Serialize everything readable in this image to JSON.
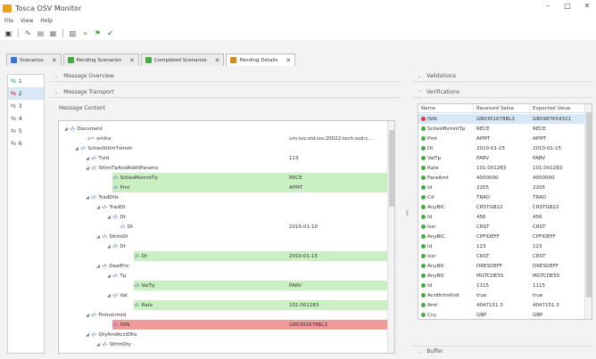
{
  "app": {
    "title": "Tosca OSV Monitor",
    "win_min": "–",
    "win_max": "□",
    "win_close": "✕"
  },
  "menu": [
    "File",
    "View",
    "Help"
  ],
  "tabs": [
    {
      "label": "Scenarios",
      "color": "#3a78c5",
      "active": false
    },
    {
      "label": "Pending Scenarios",
      "color": "#4aa64a",
      "active": false
    },
    {
      "label": "Completed Scenarios",
      "color": "#4aa64a",
      "active": false
    },
    {
      "label": "Pending Details",
      "color": "#d08a2b",
      "active": true
    }
  ],
  "tab_close": "✕",
  "list": [
    {
      "label": "1",
      "icon": "green"
    },
    {
      "label": "2",
      "icon": "red"
    },
    {
      "label": "3",
      "icon": "gray"
    },
    {
      "label": "4",
      "icon": "gray"
    },
    {
      "label": "5",
      "icon": "gray"
    },
    {
      "label": "6",
      "icon": "gray"
    }
  ],
  "center": {
    "overview": "Message Overview",
    "transport": "Message Transport",
    "content_label": "Message Content"
  },
  "tree": [
    {
      "name": "Document",
      "indent": 0,
      "arrow": "◢",
      "kind": "el",
      "value": "",
      "bg": ""
    },
    {
      "name": "xmlns",
      "indent": 2,
      "arrow": "",
      "kind": "attr",
      "value": "urn:iso:std:iso:20022:tech:xsd:c...",
      "bg": ""
    },
    {
      "name": "SctiesSttlmTxInstr",
      "indent": 1,
      "arrow": "◢",
      "kind": "el",
      "value": "",
      "bg": ""
    },
    {
      "name": "TxId",
      "indent": 2,
      "arrow": "◢",
      "kind": "el",
      "value": "123",
      "bg": ""
    },
    {
      "name": "SttlmTpAndAddtlParams",
      "indent": 2,
      "arrow": "◢",
      "kind": "el",
      "value": "",
      "bg": ""
    },
    {
      "name": "SctiesMvmntTp",
      "indent": 3,
      "arrow": "",
      "kind": "el",
      "value": "RECE",
      "bg": "green"
    },
    {
      "name": "Pmt",
      "indent": 3,
      "arrow": "",
      "kind": "el",
      "value": "APMT",
      "bg": "green"
    },
    {
      "name": "TradDtls",
      "indent": 2,
      "arrow": "◢",
      "kind": "el",
      "value": "",
      "bg": ""
    },
    {
      "name": "TradDt",
      "indent": 3,
      "arrow": "◢",
      "kind": "el",
      "value": "",
      "bg": ""
    },
    {
      "name": "Dt",
      "indent": 4,
      "arrow": "◢",
      "kind": "el",
      "value": "",
      "bg": ""
    },
    {
      "name": "Dt",
      "indent": 5,
      "arrow": "",
      "kind": "el",
      "value": "2015-01-10",
      "bg": ""
    },
    {
      "name": "SttlmDt",
      "indent": 3,
      "arrow": "◢",
      "kind": "el",
      "value": "",
      "bg": ""
    },
    {
      "name": "Dt",
      "indent": 4,
      "arrow": "◢",
      "kind": "el",
      "value": "",
      "bg": ""
    },
    {
      "name": "Dt",
      "indent": 5,
      "arrow": "",
      "kind": "el",
      "value": "2010-01-15",
      "bg": "green"
    },
    {
      "name": "DealPric",
      "indent": 3,
      "arrow": "◢",
      "kind": "el",
      "value": "",
      "bg": ""
    },
    {
      "name": "Tp",
      "indent": 4,
      "arrow": "◢",
      "kind": "el",
      "value": "",
      "bg": ""
    },
    {
      "name": "ValTp",
      "indent": 5,
      "arrow": "",
      "kind": "el",
      "value": "PARV",
      "bg": "green"
    },
    {
      "name": "Val",
      "indent": 4,
      "arrow": "◢",
      "kind": "el",
      "value": "",
      "bg": ""
    },
    {
      "name": "Rate",
      "indent": 5,
      "arrow": "",
      "kind": "el",
      "value": "101.001283",
      "bg": "green"
    },
    {
      "name": "FinInstrmId",
      "indent": 2,
      "arrow": "◢",
      "kind": "el",
      "value": "",
      "bg": ""
    },
    {
      "name": "ISIN",
      "indent": 3,
      "arrow": "",
      "kind": "el",
      "value": "GB0301678BL3",
      "bg": "red"
    },
    {
      "name": "QtyAndAcctDtls",
      "indent": 2,
      "arrow": "◢",
      "kind": "el",
      "value": "",
      "bg": ""
    },
    {
      "name": "SttlmQty",
      "indent": 3,
      "arrow": "◢",
      "kind": "el",
      "value": "",
      "bg": ""
    }
  ],
  "right": {
    "validations": "Validations",
    "verifications": "Verifications",
    "buffer": "Buffer",
    "columns": [
      "Name",
      "Received Value",
      "Expected Value"
    ]
  },
  "verifications": [
    {
      "name": "ISIN",
      "received": "GB0301678BL3",
      "expected": "GB0987654321",
      "status": "red"
    },
    {
      "name": "SctiesMvmntTp",
      "received": "RECE",
      "expected": "RECE",
      "status": "green"
    },
    {
      "name": "Pmt",
      "received": "APMT",
      "expected": "APMT",
      "status": "green"
    },
    {
      "name": "Dt",
      "received": "2010-01-15",
      "expected": "2010-01-15",
      "status": "green"
    },
    {
      "name": "ValTp",
      "received": "PARV",
      "expected": "PARV",
      "status": "green"
    },
    {
      "name": "Rate",
      "received": "101.001283",
      "expected": "101.001283",
      "status": "green"
    },
    {
      "name": "FaceAmt",
      "received": "4000000",
      "expected": "4000000",
      "status": "green"
    },
    {
      "name": "Id",
      "received": "2205",
      "expected": "2205",
      "status": "green"
    },
    {
      "name": "Cd",
      "received": "TRAD",
      "expected": "TRAD",
      "status": "green"
    },
    {
      "name": "AnyBIC",
      "received": "CRSTGB22",
      "expected": "CRSTGB22",
      "status": "green"
    },
    {
      "name": "Id",
      "received": "456",
      "expected": "456",
      "status": "green"
    },
    {
      "name": "Issr",
      "received": "CRST",
      "expected": "CRST",
      "status": "green"
    },
    {
      "name": "AnyBIC",
      "received": "CPFIDEFF",
      "expected": "CPFIDEFF",
      "status": "green"
    },
    {
      "name": "Id",
      "received": "123",
      "expected": "123",
      "status": "green"
    },
    {
      "name": "Issr",
      "received": "CRST",
      "expected": "CRST",
      "status": "green"
    },
    {
      "name": "AnyBIC",
      "received": "DRESDEFF",
      "expected": "DRESDEFF",
      "status": "green"
    },
    {
      "name": "AnyBIC",
      "received": "MGTCDE55",
      "expected": "MGTCDE55",
      "status": "green"
    },
    {
      "name": "Id",
      "received": "1115",
      "expected": "1115",
      "status": "green"
    },
    {
      "name": "AcrdIntrstInd",
      "received": "true",
      "expected": "true",
      "status": "green"
    },
    {
      "name": "Amt",
      "received": "4047151.3",
      "expected": "4047151.3",
      "status": "green"
    },
    {
      "name": "Ccy",
      "received": "GBP",
      "expected": "GBP",
      "status": "green"
    }
  ],
  "colors": {
    "green": "#c9efc3",
    "red": "#f29a9a",
    "ok": "#4aa64a",
    "err": "#d33c3c"
  }
}
